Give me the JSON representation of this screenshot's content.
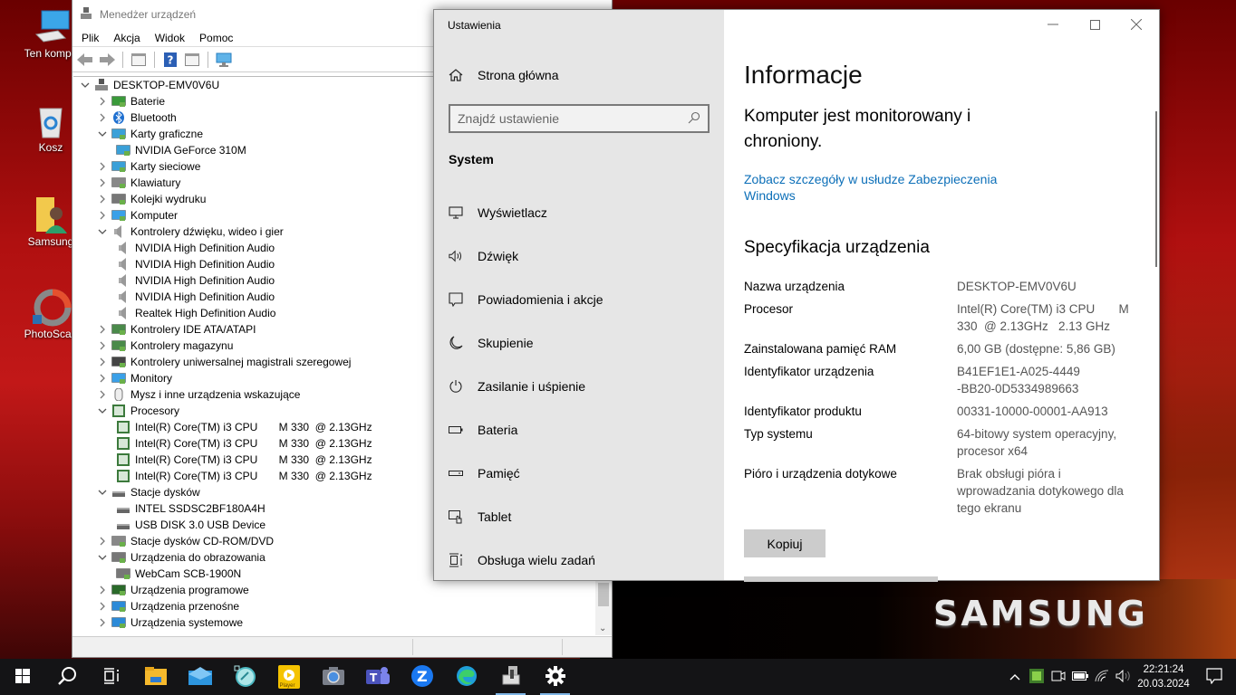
{
  "desktop": {
    "icons": [
      {
        "label": "Ten kompu",
        "icon": "this-pc-icon"
      },
      {
        "label": "Kosz",
        "icon": "recycle-bin-icon"
      },
      {
        "label": "Samsung",
        "icon": "user-folder-icon"
      },
      {
        "label": "PhotoScap",
        "icon": "photoscape-icon"
      }
    ],
    "brand": "SAMSUNG"
  },
  "device_manager": {
    "title": "Menedżer urządzeń",
    "menu": [
      "Plik",
      "Akcja",
      "Widok",
      "Pomoc"
    ],
    "toolbar": [
      "back-icon",
      "forward-icon",
      "properties-icon",
      "help-icon",
      "update-driver-icon",
      "scan-hardware-icon"
    ],
    "tree": [
      {
        "level": 0,
        "state": "expanded",
        "icon": "computer-icon",
        "label": "DESKTOP-EMV0V6U"
      },
      {
        "level": 1,
        "state": "collapsed",
        "icon": "battery-icon",
        "label": "Baterie"
      },
      {
        "level": 1,
        "state": "collapsed",
        "icon": "bluetooth-icon",
        "label": "Bluetooth"
      },
      {
        "level": 1,
        "state": "expanded",
        "icon": "display-adapter-icon",
        "label": "Karty graficzne"
      },
      {
        "level": 2,
        "state": "leaf",
        "icon": "display-adapter-icon",
        "label": "NVIDIA GeForce 310M"
      },
      {
        "level": 1,
        "state": "collapsed",
        "icon": "network-adapter-icon",
        "label": "Karty sieciowe"
      },
      {
        "level": 1,
        "state": "collapsed",
        "icon": "keyboard-icon",
        "label": "Klawiatury"
      },
      {
        "level": 1,
        "state": "collapsed",
        "icon": "printer-icon",
        "label": "Kolejki wydruku"
      },
      {
        "level": 1,
        "state": "collapsed",
        "icon": "monitor-icon",
        "label": "Komputer"
      },
      {
        "level": 1,
        "state": "expanded",
        "icon": "speaker-icon",
        "label": "Kontrolery dźwięku, wideo i gier"
      },
      {
        "level": 2,
        "state": "leaf",
        "icon": "speaker-icon",
        "label": "NVIDIA High Definition Audio"
      },
      {
        "level": 2,
        "state": "leaf",
        "icon": "speaker-icon",
        "label": "NVIDIA High Definition Audio"
      },
      {
        "level": 2,
        "state": "leaf",
        "icon": "speaker-icon",
        "label": "NVIDIA High Definition Audio"
      },
      {
        "level": 2,
        "state": "leaf",
        "icon": "speaker-icon",
        "label": "NVIDIA High Definition Audio"
      },
      {
        "level": 2,
        "state": "leaf",
        "icon": "speaker-icon",
        "label": "Realtek High Definition Audio"
      },
      {
        "level": 1,
        "state": "collapsed",
        "icon": "ide-controller-icon",
        "label": "Kontrolery IDE ATA/ATAPI"
      },
      {
        "level": 1,
        "state": "collapsed",
        "icon": "storage-controller-icon",
        "label": "Kontrolery magazynu"
      },
      {
        "level": 1,
        "state": "collapsed",
        "icon": "usb-icon",
        "label": "Kontrolery uniwersalnej magistrali szeregowej"
      },
      {
        "level": 1,
        "state": "collapsed",
        "icon": "monitor-icon",
        "label": "Monitory"
      },
      {
        "level": 1,
        "state": "collapsed",
        "icon": "mouse-icon",
        "label": "Mysz i inne urządzenia wskazujące"
      },
      {
        "level": 1,
        "state": "expanded",
        "icon": "processor-icon",
        "label": "Procesory"
      },
      {
        "level": 2,
        "state": "leaf",
        "icon": "processor-icon",
        "label": "Intel(R) Core(TM) i3 CPU       M 330  @ 2.13GHz"
      },
      {
        "level": 2,
        "state": "leaf",
        "icon": "processor-icon",
        "label": "Intel(R) Core(TM) i3 CPU       M 330  @ 2.13GHz"
      },
      {
        "level": 2,
        "state": "leaf",
        "icon": "processor-icon",
        "label": "Intel(R) Core(TM) i3 CPU       M 330  @ 2.13GHz"
      },
      {
        "level": 2,
        "state": "leaf",
        "icon": "processor-icon",
        "label": "Intel(R) Core(TM) i3 CPU       M 330  @ 2.13GHz"
      },
      {
        "level": 1,
        "state": "expanded",
        "icon": "disk-drive-icon",
        "label": "Stacje dysków"
      },
      {
        "level": 2,
        "state": "leaf",
        "icon": "disk-drive-icon",
        "label": "INTEL SSDSC2BF180A4H"
      },
      {
        "level": 2,
        "state": "leaf",
        "icon": "disk-drive-icon",
        "label": "USB DISK 3.0 USB Device"
      },
      {
        "level": 1,
        "state": "collapsed",
        "icon": "cdrom-icon",
        "label": "Stacje dysków CD-ROM/DVD"
      },
      {
        "level": 1,
        "state": "expanded",
        "icon": "webcam-icon",
        "label": "Urządzenia do obrazowania"
      },
      {
        "level": 2,
        "state": "leaf",
        "icon": "webcam-icon",
        "label": "WebCam SCB-1900N"
      },
      {
        "level": 1,
        "state": "collapsed",
        "icon": "software-device-icon",
        "label": "Urządzenia programowe"
      },
      {
        "level": 1,
        "state": "collapsed",
        "icon": "portable-device-icon",
        "label": "Urządzenia przenośne"
      },
      {
        "level": 1,
        "state": "collapsed",
        "icon": "system-device-icon",
        "label": "Urządzenia systemowe"
      }
    ]
  },
  "settings": {
    "app_title": "Ustawienia",
    "home_label": "Strona główna",
    "search_placeholder": "Znajdź ustawienie",
    "section": "System",
    "nav": [
      {
        "label": "Wyświetlacz",
        "icon": "display-icon"
      },
      {
        "label": "Dźwięk",
        "icon": "sound-icon"
      },
      {
        "label": "Powiadomienia i akcje",
        "icon": "notifications-icon"
      },
      {
        "label": "Skupienie",
        "icon": "focus-moon-icon"
      },
      {
        "label": "Zasilanie i uśpienie",
        "icon": "power-icon"
      },
      {
        "label": "Bateria",
        "icon": "battery-icon"
      },
      {
        "label": "Pamięć",
        "icon": "storage-icon"
      },
      {
        "label": "Tablet",
        "icon": "tablet-icon"
      },
      {
        "label": "Obsługa wielu zadań",
        "icon": "multitasking-icon"
      }
    ],
    "page_title": "Informacje",
    "protection_status": "Komputer jest monitorowany i chroniony.",
    "security_link": "Zobacz szczegóły w usłudze Zabezpieczenia Windows",
    "spec_heading": "Specyfikacja urządzenia",
    "specs": [
      {
        "key": "Nazwa urządzenia",
        "value": "DESKTOP-EMV0V6U"
      },
      {
        "key": "Procesor",
        "value": "Intel(R) Core(TM) i3 CPU       M 330  @ 2.13GHz   2.13 GHz"
      },
      {
        "key": "Zainstalowana pamięć RAM",
        "value": "6,00 GB (dostępne: 5,86 GB)"
      },
      {
        "key": "Identyfikator urządzenia",
        "value": "B41EF1E1-A025-4449-BB20-0D5334989663"
      },
      {
        "key": "Identyfikator produktu",
        "value": "00331-10000-00001-AA913"
      },
      {
        "key": "Typ systemu",
        "value": "64-bitowy system operacyjny, procesor x64"
      },
      {
        "key": "Pióro i urządzenia dotykowe",
        "value": "Brak obsługi pióra i wprowadzania dotykowego dla tego ekranu"
      }
    ],
    "copy_button": "Kopiuj"
  },
  "taskbar": {
    "apps": [
      {
        "name": "start",
        "icon": "windows-start-icon"
      },
      {
        "name": "search",
        "icon": "search-icon"
      },
      {
        "name": "task-view",
        "icon": "task-view-icon"
      },
      {
        "name": "file-explorer",
        "icon": "folder-icon"
      },
      {
        "name": "mail",
        "icon": "mail-icon"
      },
      {
        "name": "app-tool",
        "icon": "app-tool-icon"
      },
      {
        "name": "player",
        "icon": "player-icon"
      },
      {
        "name": "camera",
        "icon": "camera-icon"
      },
      {
        "name": "teams",
        "icon": "teams-icon"
      },
      {
        "name": "zoom",
        "icon": "z-app-icon"
      },
      {
        "name": "edge",
        "icon": "edge-icon"
      },
      {
        "name": "device-manager",
        "icon": "device-manager-icon",
        "active": true
      },
      {
        "name": "settings",
        "icon": "settings-gear-icon",
        "active": true
      }
    ],
    "player_label": "Player",
    "time": "22:21:24",
    "date": "20.03.2024"
  },
  "colors": {
    "link": "#0c6fb8",
    "taskbar": "#141416",
    "settings_nav_bg": "#e6e6e6"
  }
}
